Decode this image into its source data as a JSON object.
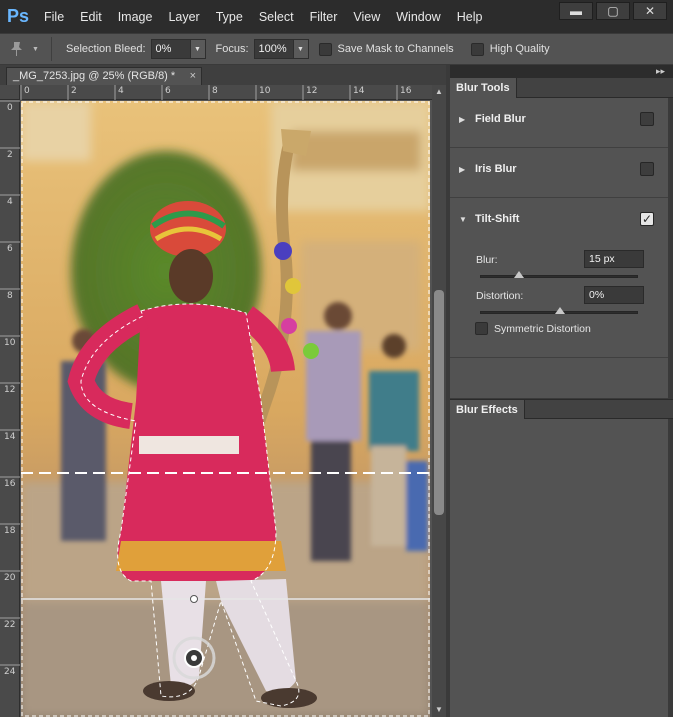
{
  "app": {
    "logo": "Ps"
  },
  "menu": [
    "File",
    "Edit",
    "Image",
    "Layer",
    "Type",
    "Select",
    "Filter",
    "View",
    "Window",
    "Help"
  ],
  "window_controls": {
    "minimize": "▬",
    "maximize": "▢",
    "close": "✕"
  },
  "options": {
    "selection_bleed_label": "Selection Bleed:",
    "selection_bleed_value": "0%",
    "focus_label": "Focus:",
    "focus_value": "100%",
    "save_mask_label": "Save Mask to Channels",
    "high_quality_label": "High Quality"
  },
  "document": {
    "tab_title": "_MG_7253.jpg @ 25% (RGB/8) *",
    "close": "×"
  },
  "rulers": {
    "horizontal": [
      "0",
      "2",
      "4",
      "6",
      "8",
      "10",
      "12",
      "14",
      "16"
    ],
    "vertical": [
      "0",
      "2",
      "4",
      "6",
      "8",
      "10",
      "12",
      "14",
      "16",
      "18",
      "20",
      "22",
      "24"
    ]
  },
  "panel": {
    "collapse_glyph": "▸▸",
    "blur_tools_tab": "Blur Tools",
    "field_blur": "Field Blur",
    "iris_blur": "Iris Blur",
    "tilt_shift": "Tilt-Shift",
    "blur_label": "Blur:",
    "blur_value": "15 px",
    "blur_slider_fraction": 0.24,
    "distortion_label": "Distortion:",
    "distortion_value": "0%",
    "distortion_slider_fraction": 0.5,
    "symmetric_label": "Symmetric Distortion",
    "blur_effects_tab": "Blur Effects",
    "checkmark": "✓"
  },
  "colors": {
    "ps_blue": "#6ab7ff",
    "panel_bg": "#535353",
    "menubar_bg": "#2c2c2c"
  },
  "icons": {
    "tool_preset": "pin-icon",
    "expand": "triangle-right-icon",
    "collapse": "triangle-down-icon"
  }
}
